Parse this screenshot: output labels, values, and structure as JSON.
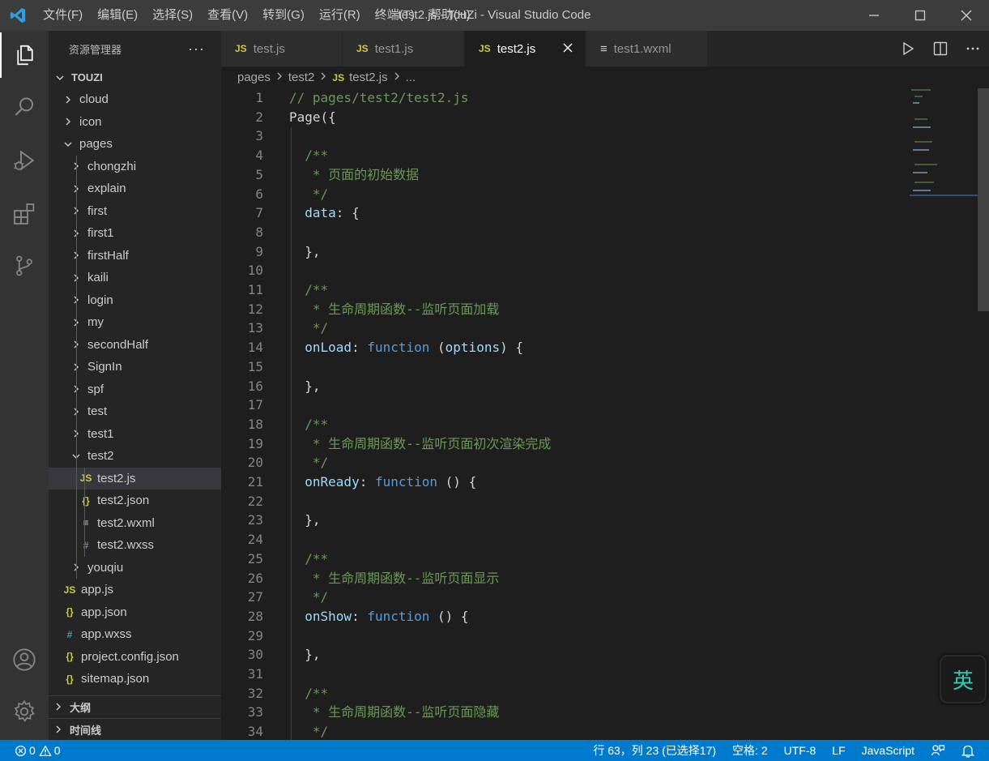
{
  "window": {
    "title": "test2.js - TouZi - Visual Studio Code",
    "app_icon": "vscode-logo-icon"
  },
  "menu": [
    "文件(F)",
    "编辑(E)",
    "选择(S)",
    "查看(V)",
    "转到(G)",
    "运行(R)",
    "终端(T)",
    "帮助(H)"
  ],
  "sidebar": {
    "title": "资源管理器",
    "more_label": "···",
    "root": "TOUZI",
    "tree": [
      {
        "label": "cloud",
        "kind": "folder",
        "depth": 1,
        "open": false
      },
      {
        "label": "icon",
        "kind": "folder",
        "depth": 1,
        "open": false
      },
      {
        "label": "pages",
        "kind": "folder",
        "depth": 1,
        "open": true
      },
      {
        "label": "chongzhi",
        "kind": "folder",
        "depth": 2,
        "open": false
      },
      {
        "label": "explain",
        "kind": "folder",
        "depth": 2,
        "open": false
      },
      {
        "label": "first",
        "kind": "folder",
        "depth": 2,
        "open": false
      },
      {
        "label": "first1",
        "kind": "folder",
        "depth": 2,
        "open": false
      },
      {
        "label": "firstHalf",
        "kind": "folder",
        "depth": 2,
        "open": false
      },
      {
        "label": "kaili",
        "kind": "folder",
        "depth": 2,
        "open": false
      },
      {
        "label": "login",
        "kind": "folder",
        "depth": 2,
        "open": false
      },
      {
        "label": "my",
        "kind": "folder",
        "depth": 2,
        "open": false
      },
      {
        "label": "secondHalf",
        "kind": "folder",
        "depth": 2,
        "open": false
      },
      {
        "label": "SignIn",
        "kind": "folder",
        "depth": 2,
        "open": false
      },
      {
        "label": "spf",
        "kind": "folder",
        "depth": 2,
        "open": false
      },
      {
        "label": "test",
        "kind": "folder",
        "depth": 2,
        "open": false
      },
      {
        "label": "test1",
        "kind": "folder",
        "depth": 2,
        "open": false
      },
      {
        "label": "test2",
        "kind": "folder",
        "depth": 2,
        "open": true
      },
      {
        "label": "test2.js",
        "kind": "js",
        "icon_text": "JS",
        "depth": 3,
        "selected": true
      },
      {
        "label": "test2.json",
        "kind": "json",
        "icon_text": "{}",
        "depth": 3
      },
      {
        "label": "test2.wxml",
        "kind": "wxml",
        "icon_text": "≡",
        "depth": 3
      },
      {
        "label": "test2.wxss",
        "kind": "wxss",
        "icon_text": "#",
        "depth": 3
      },
      {
        "label": "youqiu",
        "kind": "folder",
        "depth": 2,
        "open": false
      },
      {
        "label": "app.js",
        "kind": "js",
        "icon_text": "JS",
        "depth": 1
      },
      {
        "label": "app.json",
        "kind": "json",
        "icon_text": "{}",
        "depth": 1
      },
      {
        "label": "app.wxss",
        "kind": "wxss",
        "icon_text": "#",
        "depth": 1
      },
      {
        "label": "project.config.json",
        "kind": "json",
        "icon_text": "{}",
        "depth": 1
      },
      {
        "label": "sitemap.json",
        "kind": "json",
        "icon_text": "{}",
        "depth": 1
      }
    ],
    "panels": [
      "大纲",
      "时间线"
    ]
  },
  "tabs": [
    {
      "label": "test.js",
      "icon_text": "JS",
      "active": false
    },
    {
      "label": "test1.js",
      "icon_text": "JS",
      "active": false
    },
    {
      "label": "test2.js",
      "icon_text": "JS",
      "active": true
    },
    {
      "label": "test1.wxml",
      "icon_text": "≡",
      "active": false
    }
  ],
  "breadcrumb": {
    "parts": [
      "pages",
      "test2"
    ],
    "file_icon": "JS",
    "file": "test2.js",
    "more": "..."
  },
  "code_lines": [
    [
      [
        "c",
        "// pages/test2/test2.js"
      ]
    ],
    [
      [
        "i",
        "Page({"
      ]
    ],
    [],
    [
      [
        "c",
        "  /**"
      ]
    ],
    [
      [
        "c",
        "   * 页面的初始数据"
      ]
    ],
    [
      [
        "c",
        "   */"
      ]
    ],
    [
      [
        "p",
        "  data"
      ],
      [
        "i",
        ": {"
      ]
    ],
    [],
    [
      [
        "i",
        "  },"
      ]
    ],
    [],
    [
      [
        "c",
        "  /**"
      ]
    ],
    [
      [
        "c",
        "   * 生命周期函数--监听页面加载"
      ]
    ],
    [
      [
        "c",
        "   */"
      ]
    ],
    [
      [
        "p",
        "  onLoad"
      ],
      [
        "i",
        ": "
      ],
      [
        "k",
        "function"
      ],
      [
        "i",
        " ("
      ],
      [
        "p",
        "options"
      ],
      [
        "i",
        ") {"
      ]
    ],
    [],
    [
      [
        "i",
        "  },"
      ]
    ],
    [],
    [
      [
        "c",
        "  /**"
      ]
    ],
    [
      [
        "c",
        "   * 生命周期函数--监听页面初次渲染完成"
      ]
    ],
    [
      [
        "c",
        "   */"
      ]
    ],
    [
      [
        "p",
        "  onReady"
      ],
      [
        "i",
        ": "
      ],
      [
        "k",
        "function"
      ],
      [
        "i",
        " () {"
      ]
    ],
    [],
    [
      [
        "i",
        "  },"
      ]
    ],
    [],
    [
      [
        "c",
        "  /**"
      ]
    ],
    [
      [
        "c",
        "   * 生命周期函数--监听页面显示"
      ]
    ],
    [
      [
        "c",
        "   */"
      ]
    ],
    [
      [
        "p",
        "  onShow"
      ],
      [
        "i",
        ": "
      ],
      [
        "k",
        "function"
      ],
      [
        "i",
        " () {"
      ]
    ],
    [],
    [
      [
        "i",
        "  },"
      ]
    ],
    [],
    [
      [
        "c",
        "  /**"
      ]
    ],
    [
      [
        "c",
        "   * 生命周期函数--监听页面隐藏"
      ]
    ],
    [
      [
        "c",
        "   */"
      ]
    ]
  ],
  "ime": {
    "label": "英"
  },
  "status": {
    "errors": "0",
    "warnings": "0",
    "position": "行 63，列 23 (已选择17)",
    "spaces": "空格: 2",
    "encoding": "UTF-8",
    "eol": "LF",
    "language": "JavaScript"
  },
  "colors": {
    "accent": "#007acc",
    "js_icon": "#cbcb41",
    "json_icon": "#cbcb41",
    "wxss_icon": "#519aba",
    "comment": "#6a9955",
    "keyword": "#569cd6",
    "property": "#9cdcfe"
  }
}
